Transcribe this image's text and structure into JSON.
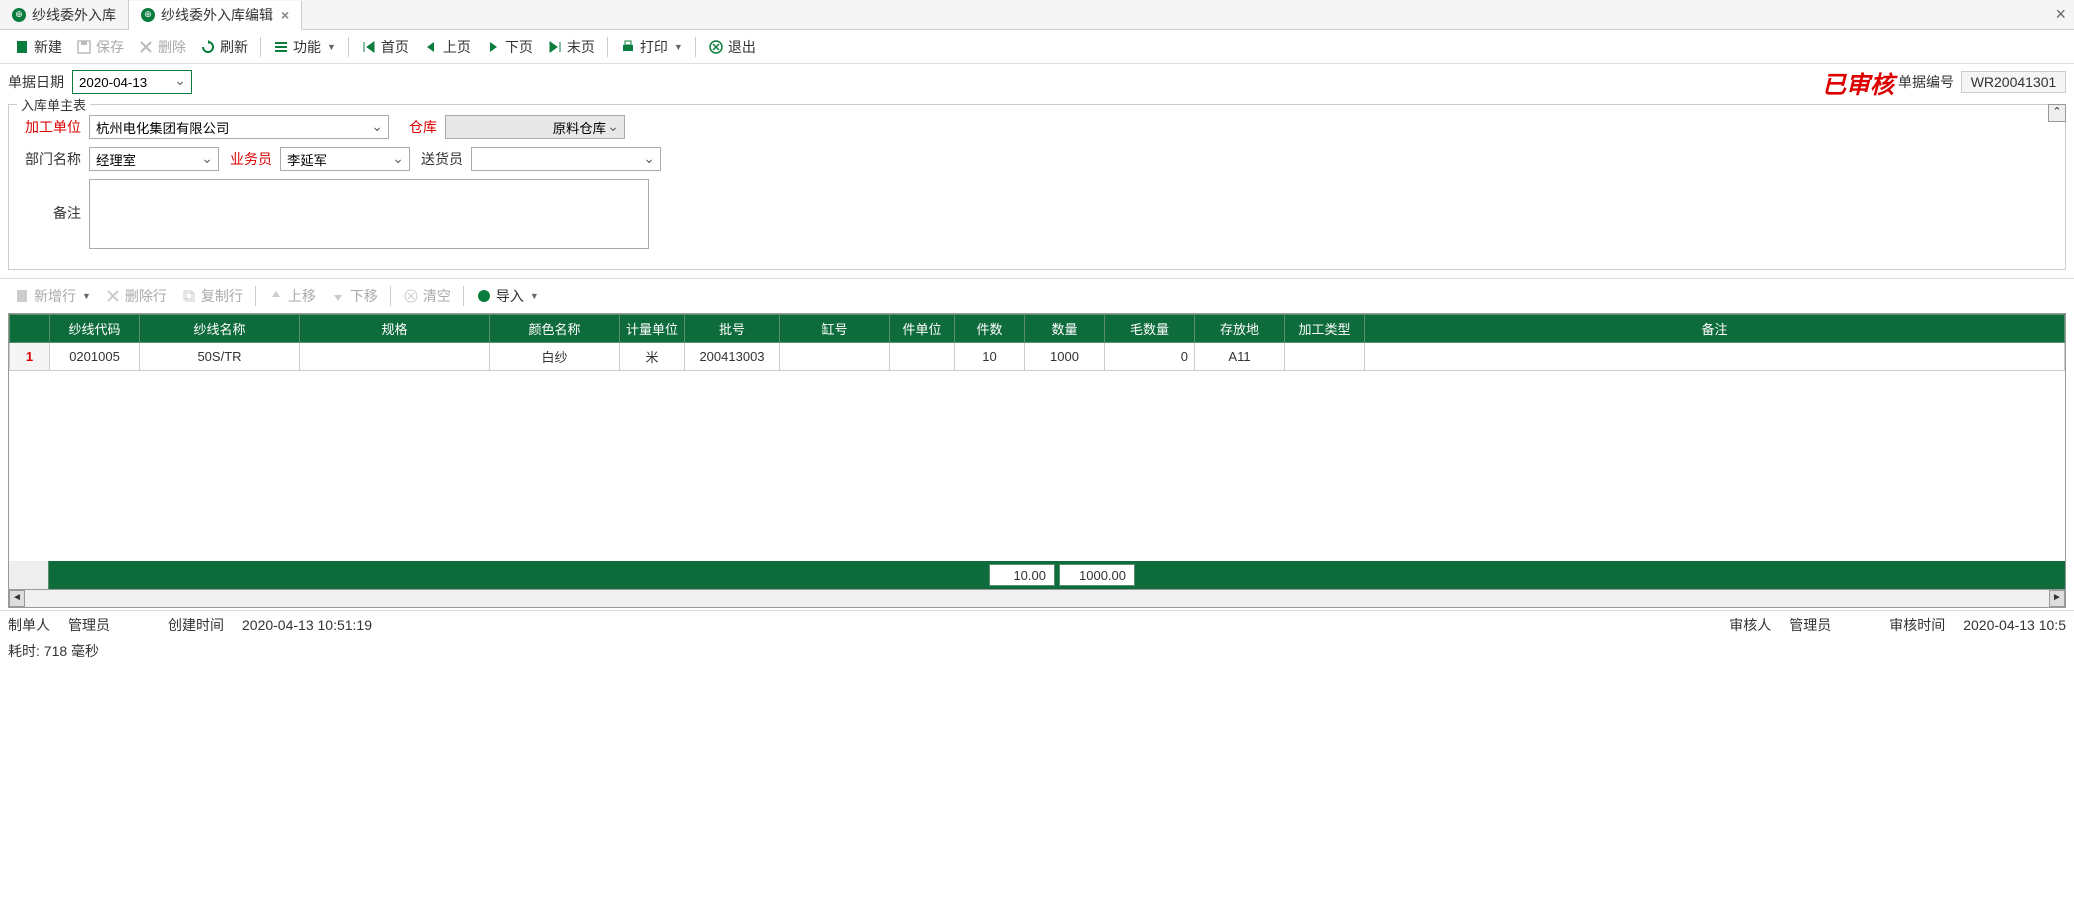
{
  "tabs": [
    {
      "label": "纱线委外入库"
    },
    {
      "label": "纱线委外入库编辑"
    }
  ],
  "toolbar": {
    "new": "新建",
    "save": "保存",
    "delete": "删除",
    "refresh": "刷新",
    "function": "功能",
    "first": "首页",
    "prev": "上页",
    "next": "下页",
    "last": "末页",
    "print": "打印",
    "exit": "退出"
  },
  "date_label": "单据日期",
  "date_value": "2020-04-13",
  "stamp": "已审核",
  "doc_no_label": "单据编号",
  "doc_no_value": "WR20041301",
  "fieldset_title": "入库单主表",
  "form": {
    "processor_label": "加工单位",
    "processor_value": "杭州电化集团有限公司",
    "warehouse_label": "仓库",
    "warehouse_value": "原料仓库",
    "dept_label": "部门名称",
    "dept_value": "经理室",
    "sales_label": "业务员",
    "sales_value": "李延军",
    "deliverer_label": "送货员",
    "deliverer_value": "",
    "remark_label": "备注",
    "remark_value": ""
  },
  "grid_toolbar": {
    "addrow": "新增行",
    "delrow": "删除行",
    "copyrow": "复制行",
    "moveup": "上移",
    "movedown": "下移",
    "clear": "清空",
    "import": "导入"
  },
  "grid": {
    "columns": [
      "纱线代码",
      "纱线名称",
      "规格",
      "颜色名称",
      "计量单位",
      "批号",
      "缸号",
      "件单位",
      "件数",
      "数量",
      "毛数量",
      "存放地",
      "加工类型",
      "备注"
    ],
    "rows": [
      {
        "num": "1",
        "yarn_code": "0201005",
        "yarn_name": "50S/TR",
        "spec": "",
        "color": "白纱",
        "unit": "米",
        "batch": "200413003",
        "vat": "",
        "piece_unit": "",
        "pieces": "10",
        "qty": "1000",
        "gross": "0",
        "location": "A11",
        "proc_type": "",
        "remark": ""
      }
    ],
    "footer": {
      "pieces": "10.00",
      "qty": "1000.00"
    }
  },
  "status": {
    "creator_label": "制单人",
    "creator": "管理员",
    "create_time_label": "创建时间",
    "create_time": "2020-04-13 10:51:19",
    "auditor_label": "审核人",
    "auditor": "管理员",
    "audit_time_label": "审核时间",
    "audit_time": "2020-04-13 10:5"
  },
  "timing": "耗时: 718 毫秒"
}
